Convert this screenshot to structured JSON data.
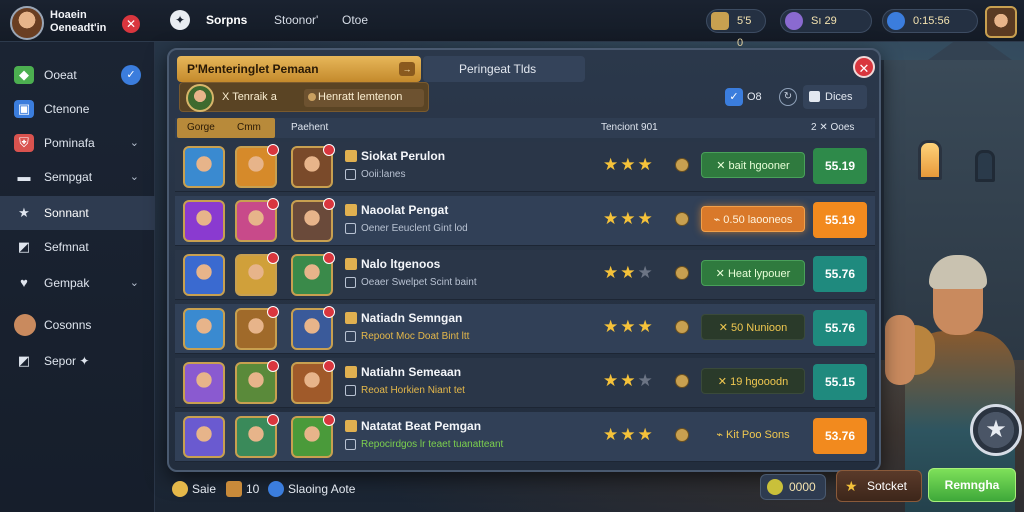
{
  "topbar": {
    "profile_name_line1": "Hoaein",
    "profile_name_line2": "Oeneadt'in",
    "close_label": "✕",
    "logo_glyph": "✦",
    "nav": [
      "Sorpns",
      "Stoonor'",
      "Otoe"
    ],
    "resources": [
      {
        "label": "5'5 0",
        "icon": "coin-icon",
        "color": "#c8a050"
      },
      {
        "label": "Sı 29",
        "icon": "gem-icon",
        "color": "#8a6ad0"
      },
      {
        "label": "0:15:56",
        "icon": "timer-icon",
        "color": "#3b7ddd"
      }
    ]
  },
  "sidebar": {
    "items": [
      {
        "label": "Ooeat",
        "icon": "cube-icon",
        "color": "#4caf50",
        "badge": "✓",
        "chevron": ""
      },
      {
        "label": "Ctenone",
        "icon": "cube-icon",
        "color": "#3b7ddd",
        "badge": "",
        "chevron": ""
      },
      {
        "label": "Pominafa",
        "icon": "shield-icon",
        "color": "#d9534f",
        "badge": "",
        "chevron": "⌄"
      },
      {
        "label": "Sempgat",
        "icon": "bag-icon",
        "color": "#dfe5ee",
        "badge": "",
        "chevron": "⌄"
      },
      {
        "label": "Sonnant",
        "icon": "star-icon",
        "color": "#dfe5ee",
        "badge": "",
        "chevron": ""
      },
      {
        "label": "Sefmnat",
        "icon": "chart-icon",
        "color": "#dfe5ee",
        "badge": "",
        "chevron": ""
      },
      {
        "label": "Gempak",
        "icon": "heart-icon",
        "color": "#dfe5ee",
        "badge": "",
        "chevron": "⌄"
      },
      {
        "label": "Cosonns",
        "icon": "avatar-icon",
        "color": "#c98a5e",
        "badge": "",
        "chevron": ""
      },
      {
        "label": "Sepor ✦",
        "icon": "chart-icon",
        "color": "#dfe5ee",
        "badge": "",
        "chevron": ""
      }
    ]
  },
  "modal": {
    "tab_active": "P'Menteringlet Pemaan",
    "tab_inactive": "Peringeat Tlds",
    "close_label": "✕",
    "filter_text1": "X Tenraik a",
    "filter_text2": "Henratt lemtenon",
    "check_label": "O8",
    "circle_label": "↻",
    "sort_label": "Dices",
    "columns": {
      "tab1": "Gorge",
      "tab2": "Cmm",
      "c3": "Paehent",
      "c4": "Tenciont 901",
      "c5": "2 ✕ Ooes"
    },
    "rows": [
      {
        "title": "Siokat Perulon",
        "sub": "Ooii:lanes",
        "sub_style": "plain",
        "stars": 3,
        "reward": "✕ bait hgooner",
        "reward_style": "green",
        "price": "55.19",
        "price_style": "green"
      },
      {
        "title": "Naoolat Pengat",
        "sub": "Oener Eeuclent Gint lod",
        "sub_style": "plain",
        "stars": 3,
        "reward": "⌁ 0.50 laooneos",
        "reward_style": "orange",
        "price": "55.19",
        "price_style": "orange"
      },
      {
        "title": "Nalo ltgenoos",
        "sub": "Oeaer Swelpet Scint baint",
        "sub_style": "plain",
        "stars": 2,
        "reward": "✕ Heat lypouer",
        "reward_style": "green",
        "price": "55.76",
        "price_style": "teal"
      },
      {
        "title": "Natiadn Semngan",
        "sub": "Repoot Moc Doat Bint ltt",
        "sub_style": "gold",
        "stars": 3,
        "reward": "✕ 50 Nunioon",
        "reward_style": "dark",
        "price": "55.76",
        "price_style": "teal"
      },
      {
        "title": "Natiahn Semeaan",
        "sub": "Reoat Horkien Niant tet",
        "sub_style": "gold",
        "stars": 2,
        "reward": "✕ 19 hgooodn",
        "reward_style": "dark",
        "price": "55.15",
        "price_style": "teal"
      },
      {
        "title": "Natatat Beat Pemgan",
        "sub": "Repocirdgos lr teaet tuanatteant",
        "sub_style": "green",
        "stars": 3,
        "reward": "⌁ Kit Poo Sons",
        "reward_style": "none",
        "price": "53.76",
        "price_style": "orange"
      }
    ]
  },
  "bottom": {
    "label1": "Saie",
    "label2": "10",
    "label3": "Slaoing Aote",
    "counter": "0000",
    "secondary_btn": "Sotcket",
    "primary_btn": "Remngha",
    "fab_glyph": "★"
  },
  "colors": {
    "accent_gold": "#c8a050",
    "primary_green": "#4caf50",
    "danger_red": "#d9363e"
  }
}
